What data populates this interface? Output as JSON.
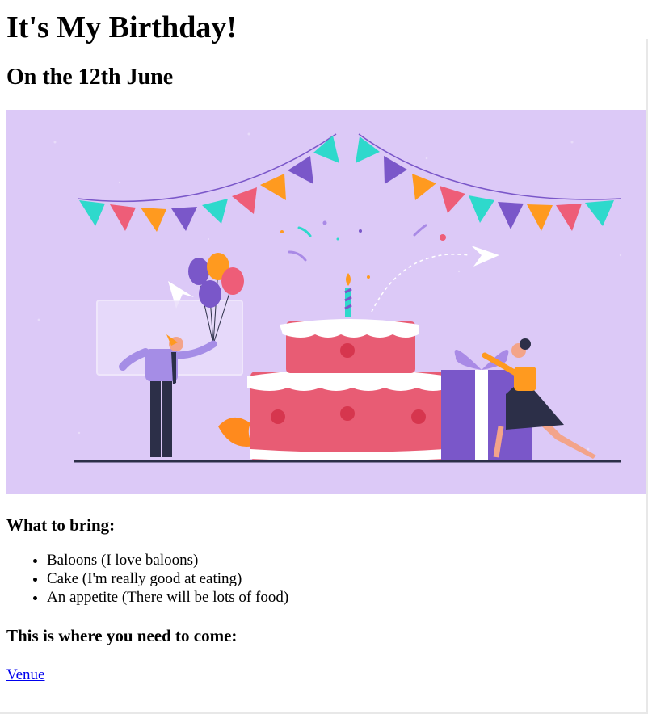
{
  "page": {
    "title": "It's My Birthday!",
    "date": "On the 12th June",
    "hero_image": {
      "background_color": "#dcc9f7",
      "palette": {
        "teal": "#2ed9cc",
        "purple": "#7a57c9",
        "orange": "#ff9a1f",
        "pink": "#ee5d78",
        "cake_red": "#e85c74",
        "icing": "#ffffff",
        "leaf": "#ff8a1d",
        "ground": "#2c2f48"
      }
    },
    "bring_heading": "What to bring:",
    "bring_items": [
      "Baloons (I love baloons)",
      "Cake (I'm really good at eating)",
      "An appetite (There will be lots of food)"
    ],
    "where_heading": "This is where you need to come:",
    "venue_link": "Venue"
  }
}
